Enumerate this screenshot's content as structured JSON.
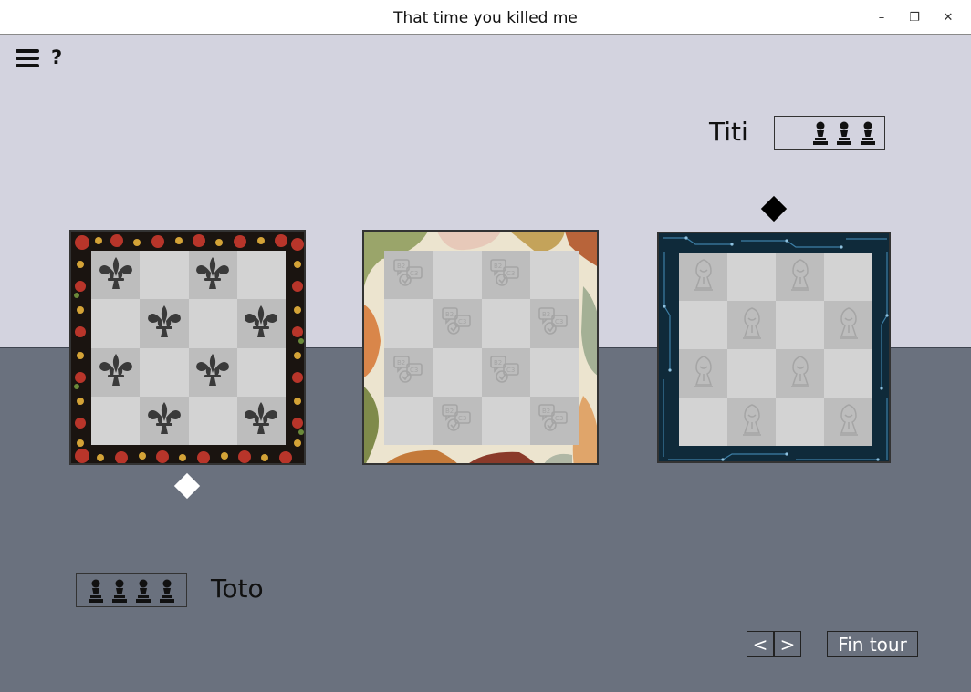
{
  "window": {
    "title": "That time you killed me",
    "controls": [
      "minimize-icon",
      "restore-icon",
      "close-icon"
    ]
  },
  "toolbar": {
    "menu_icon": "hamburger-menu-icon",
    "help_label": "?"
  },
  "players": {
    "top": {
      "name": "Titi",
      "pawns": 3,
      "turn_marker_color": "#000000"
    },
    "bottom": {
      "name": "Toto",
      "pawns": 4,
      "turn_marker_color": "#ffffff"
    }
  },
  "boards": [
    {
      "id": "left",
      "theme": "baroque-ornament",
      "piece_icon": "fleur-de-lis-icon",
      "pieces": [
        [
          0,
          0
        ],
        [
          0,
          2
        ],
        [
          1,
          1
        ],
        [
          1,
          3
        ],
        [
          2,
          0
        ],
        [
          2,
          2
        ],
        [
          3,
          1
        ],
        [
          3,
          3
        ]
      ]
    },
    {
      "id": "middle",
      "theme": "abstract-paint",
      "piece_icon": "chat-bubbles-icon",
      "pieces": [
        [
          0,
          0
        ],
        [
          0,
          2
        ],
        [
          1,
          1
        ],
        [
          1,
          3
        ],
        [
          2,
          0
        ],
        [
          2,
          2
        ],
        [
          3,
          1
        ],
        [
          3,
          3
        ]
      ]
    },
    {
      "id": "right",
      "theme": "circuit-board",
      "piece_icon": "hooded-figure-icon",
      "pieces": [
        [
          0,
          0
        ],
        [
          0,
          2
        ],
        [
          1,
          1
        ],
        [
          1,
          3
        ],
        [
          2,
          0
        ],
        [
          2,
          2
        ],
        [
          3,
          1
        ],
        [
          3,
          3
        ]
      ]
    }
  ],
  "controls": {
    "prev_label": "<",
    "next_label": ">",
    "end_turn_label": "Fin tour"
  },
  "colors": {
    "top_background": "#d3d3df",
    "bottom_background": "#6a717e",
    "cell_light": "#d3d3d3",
    "cell_dark": "#bdbdbd"
  }
}
